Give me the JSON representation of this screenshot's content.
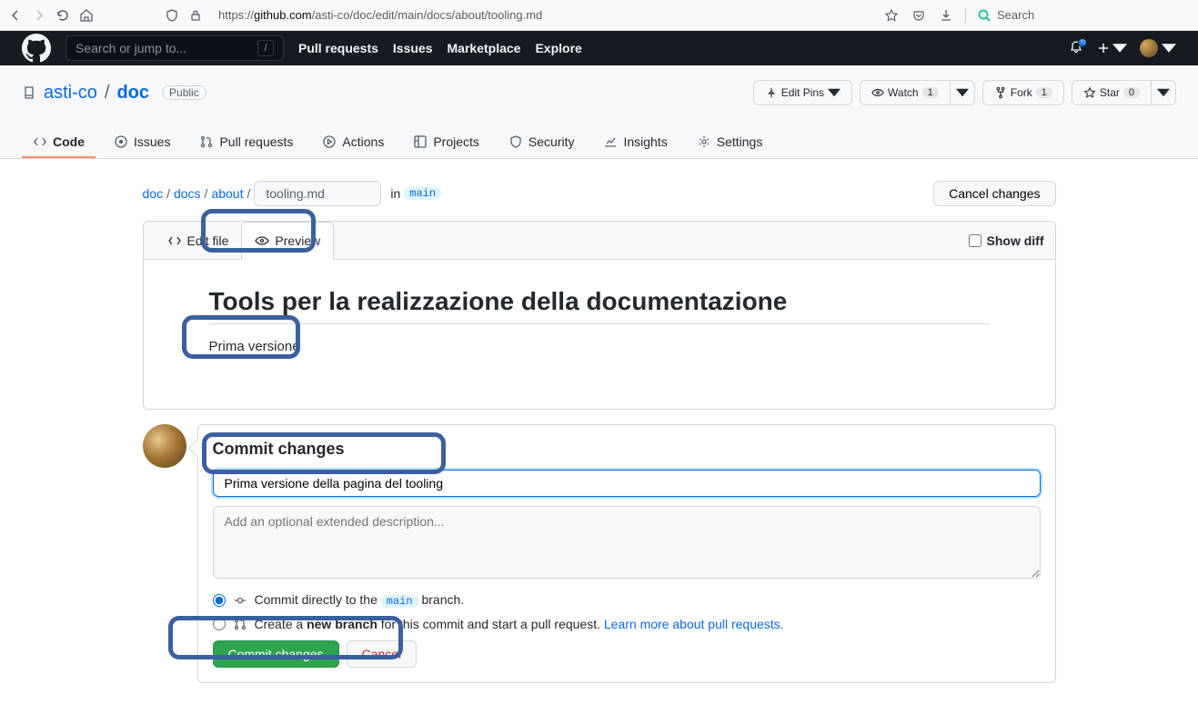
{
  "browser": {
    "url_prefix": "https://",
    "url_host": "github.com",
    "url_path": "/asti-co/doc/edit/main/docs/about/tooling.md",
    "search_placeholder": "Search"
  },
  "gh_header": {
    "search_placeholder": "Search or jump to...",
    "nav": [
      "Pull requests",
      "Issues",
      "Marketplace",
      "Explore"
    ]
  },
  "repo": {
    "owner": "asti-co",
    "name": "doc",
    "visibility": "Public",
    "actions": {
      "edit_pins": "Edit Pins",
      "watch": "Watch",
      "watch_count": "1",
      "fork": "Fork",
      "fork_count": "1",
      "star": "Star",
      "star_count": "0"
    },
    "tabs": [
      "Code",
      "Issues",
      "Pull requests",
      "Actions",
      "Projects",
      "Security",
      "Insights",
      "Settings"
    ]
  },
  "breadcrumb": {
    "seg0": "doc",
    "seg1": "docs",
    "seg2": "about",
    "filename": "tooling.md",
    "in_label": "in",
    "branch": "main",
    "cancel": "Cancel changes"
  },
  "editor": {
    "edit_tab": "Edit file",
    "preview_tab": "Preview",
    "show_diff": "Show diff",
    "heading": "Tools per la realizzazione della documentazione",
    "body": "Prima versione"
  },
  "commit": {
    "title": "Commit changes",
    "summary_value": "Prima versione della pagina del tooling",
    "desc_placeholder": "Add an optional extended description...",
    "radio_direct_prefix": "Commit directly to the ",
    "radio_direct_branch": "main",
    "radio_direct_suffix": " branch.",
    "radio_new_prefix": "Create a ",
    "radio_new_bold": "new branch",
    "radio_new_suffix": " for this commit and start a pull request. ",
    "learn_more": "Learn more about pull requests.",
    "commit_btn": "Commit changes",
    "cancel_btn": "Cancel"
  }
}
